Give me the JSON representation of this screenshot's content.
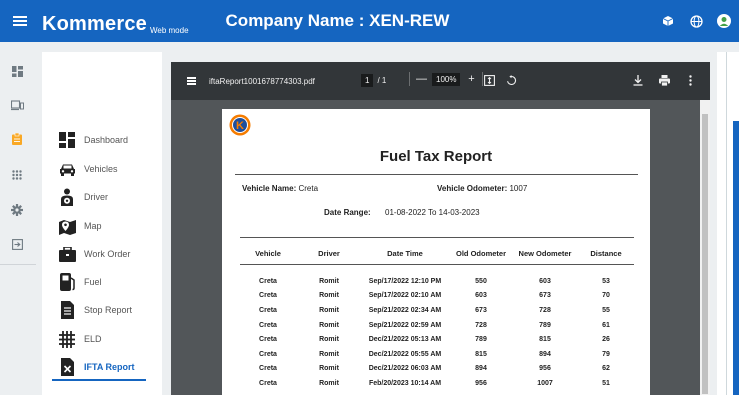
{
  "appbar": {
    "brand": "Kommerce",
    "mode": "Web mode",
    "company": "Company Name : XEN-REW",
    "icons": [
      "cube-icon",
      "globe-icon",
      "user-avatar-icon"
    ]
  },
  "rail": {
    "items": [
      "dashboard-icon",
      "devices-icon",
      "clipboard-icon",
      "apps-grid-icon",
      "settings-icon",
      "logout-icon"
    ]
  },
  "nav": {
    "items": [
      {
        "label": "Dashboard",
        "icon": "dashboard-icon"
      },
      {
        "label": "Vehicles",
        "icon": "car-icon"
      },
      {
        "label": "Driver",
        "icon": "driver-icon"
      },
      {
        "label": "Map",
        "icon": "map-icon"
      },
      {
        "label": "Work Order",
        "icon": "briefcase-icon"
      },
      {
        "label": "Fuel",
        "icon": "fuel-icon"
      },
      {
        "label": "Stop Report",
        "icon": "report-icon"
      },
      {
        "label": "ELD",
        "icon": "eld-icon"
      },
      {
        "label": "IFTA Report",
        "icon": "ifta-icon"
      }
    ],
    "active": "IFTA Report"
  },
  "pdf": {
    "filename": "iftaReport1001678774303.pdf",
    "page_current": "1",
    "page_total": "/ 1",
    "zoom": "100%",
    "zoom_out": "—",
    "zoom_in": "+"
  },
  "report": {
    "logo_letter": "K",
    "title": "Fuel Tax Report",
    "vehicle_name_label": "Vehicle Name:",
    "vehicle_name": "Creta",
    "odometer_label": "Vehicle Odometer:",
    "odometer": "1007",
    "date_range_label": "Date Range:",
    "date_range": "01-08-2022 To 14-03-2023",
    "columns": [
      "Vehicle",
      "Driver",
      "Date Time",
      "Old Odometer",
      "New Odometer",
      "Distance"
    ],
    "rows": [
      [
        "Creta",
        "Romit",
        "Sep/17/2022 12:10 PM",
        "550",
        "603",
        "53"
      ],
      [
        "Creta",
        "Romit",
        "Sep/17/2022 02:10 AM",
        "603",
        "673",
        "70"
      ],
      [
        "Creta",
        "Romit",
        "Sep/21/2022 02:34 AM",
        "673",
        "728",
        "55"
      ],
      [
        "Creta",
        "Romit",
        "Sep/21/2022 02:59 AM",
        "728",
        "789",
        "61"
      ],
      [
        "Creta",
        "Romit",
        "Dec/21/2022 05:13 AM",
        "789",
        "815",
        "26"
      ],
      [
        "Creta",
        "Romit",
        "Dec/21/2022 05:55 AM",
        "815",
        "894",
        "79"
      ],
      [
        "Creta",
        "Romit",
        "Dec/21/2022 06:03 AM",
        "894",
        "956",
        "62"
      ],
      [
        "Creta",
        "Romit",
        "Feb/20/2023 10:14 AM",
        "956",
        "1007",
        "51"
      ]
    ]
  },
  "colors": {
    "primary": "#1565c0",
    "pdf_toolbar": "#323639",
    "pdf_background": "#525659",
    "logo_orange": "#f57c00",
    "logo_blue": "#1e4e9c"
  }
}
